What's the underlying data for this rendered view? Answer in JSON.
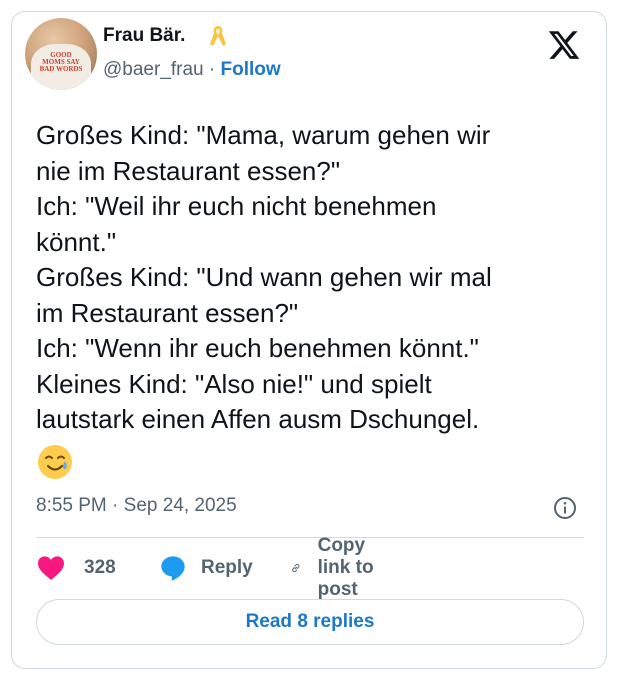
{
  "author": {
    "name": "Frau Bär.",
    "handle": "@baer_frau",
    "separator": "·",
    "follow_label": "Follow",
    "avatar_shirt_text": "GOOD MOMS SAY BAD WORDS"
  },
  "tweet": {
    "lines": [
      "Großes Kind: \"Mama, warum gehen wir",
      "nie im Restaurant essen?\"",
      "Ich: \"Weil ihr euch nicht benehmen",
      "könnt.\"",
      "Großes Kind: \"Und wann gehen wir mal",
      "im Restaurant essen?\"",
      "Ich: \"Wenn ihr euch benehmen könnt.\"",
      "Kleines Kind: \"Also nie!\" und spielt",
      "lautstark einen Affen ausm Dschungel."
    ],
    "emoji": "🥲",
    "timestamp": "8:55 PM · Sep 24, 2025"
  },
  "actions": {
    "likes_count": "328",
    "reply_label": "Reply",
    "copy_link_label": "Copy link to post"
  },
  "read_replies_label": "Read 8 replies",
  "colors": {
    "accent": "#1d78c8",
    "like": "#f91880",
    "muted": "#536471",
    "border": "#cfd9de"
  }
}
